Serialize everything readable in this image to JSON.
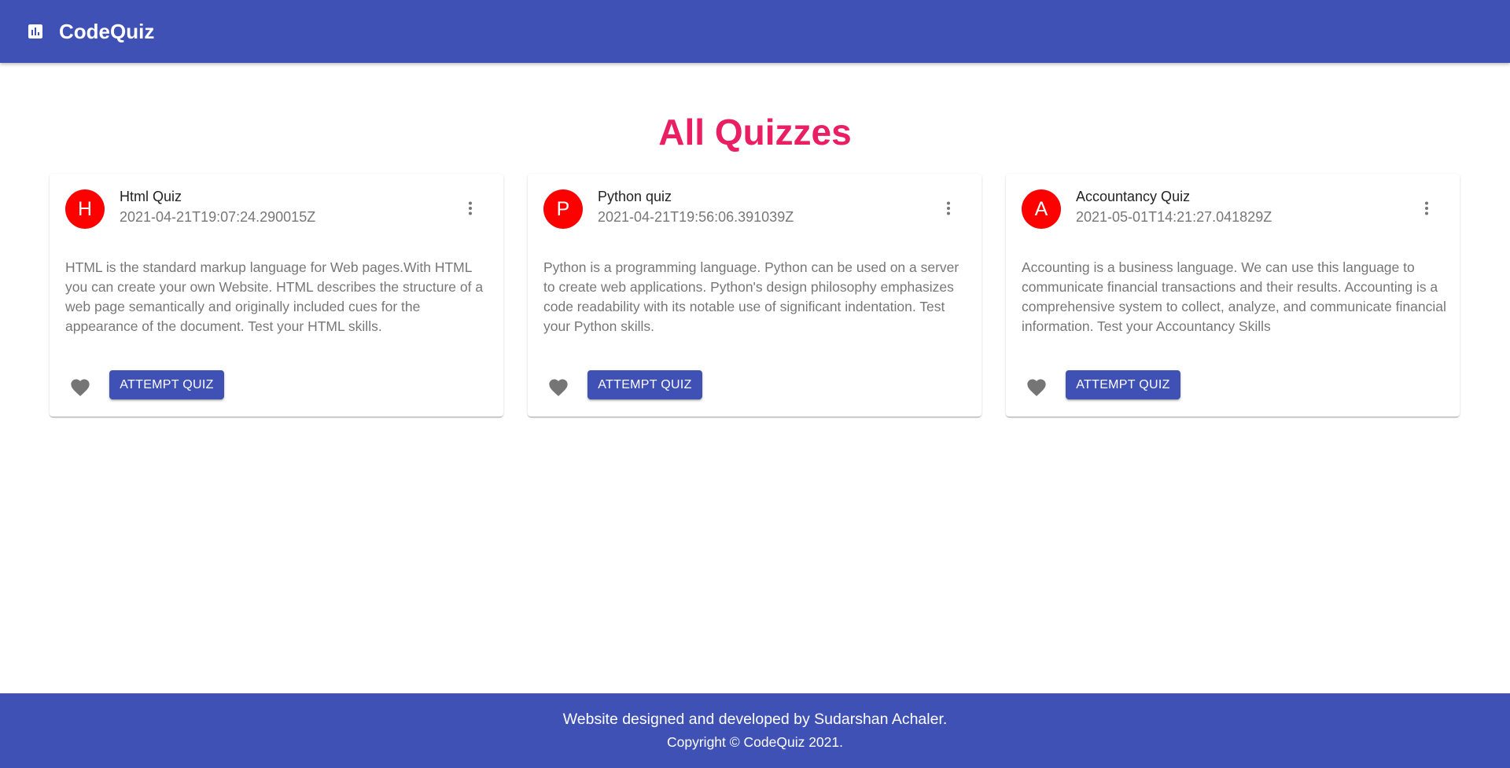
{
  "app": {
    "brand": "CodeQuiz",
    "logo_icon": "bar-chart-icon"
  },
  "page": {
    "title": "All Quizzes"
  },
  "quizzes": [
    {
      "avatar": "H",
      "title": "Html Quiz",
      "timestamp": "2021-04-21T19:07:24.290015Z",
      "description": "HTML is the standard markup language for Web pages.With HTML you can create your own Website. HTML describes the structure of a web page semantically and originally included cues for the appearance of the document. Test your HTML skills.",
      "button_label": "ATTEMPT QUIZ"
    },
    {
      "avatar": "P",
      "title": "Python quiz",
      "timestamp": "2021-04-21T19:56:06.391039Z",
      "description": "Python is a programming language. Python can be used on a server to create web applications. Python's design philosophy emphasizes code readability with its notable use of significant indentation. Test your Python skills.",
      "button_label": "ATTEMPT QUIZ"
    },
    {
      "avatar": "A",
      "title": "Accountancy Quiz",
      "timestamp": "2021-05-01T14:21:27.041829Z",
      "description": "Accounting is a business language. We can use this language to communicate financial transactions and their results. Accounting is a comprehensive system to collect, analyze, and communicate financial information. Test your Accountancy Skills",
      "button_label": "ATTEMPT QUIZ"
    }
  ],
  "footer": {
    "line1": "Website designed and developed by Sudarshan Achaler.",
    "line2": "Copyright © CodeQuiz 2021."
  },
  "colors": {
    "primary": "#3f51b5",
    "title": "#e91e63",
    "avatar": "#ff0000",
    "icon": "#757575"
  }
}
